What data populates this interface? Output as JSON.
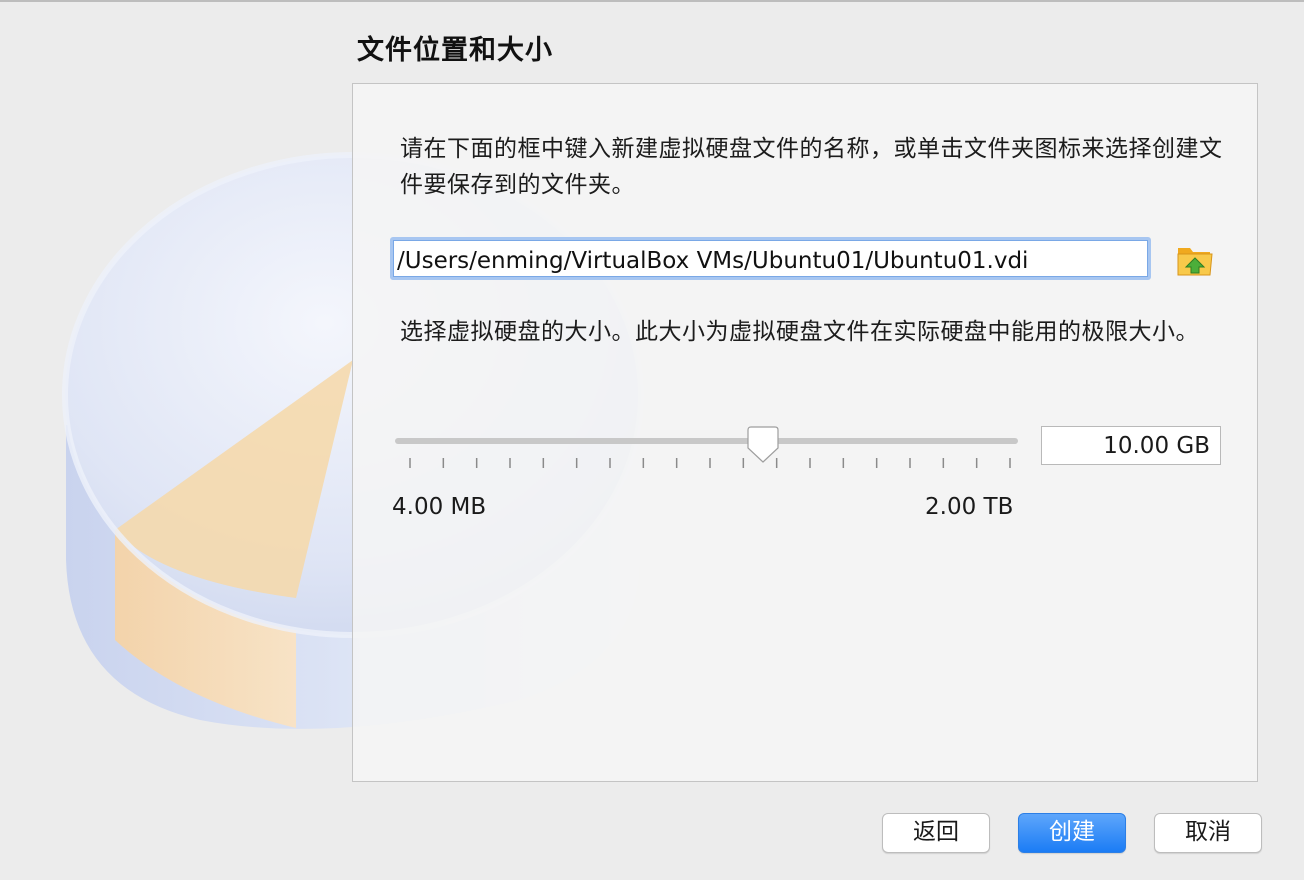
{
  "page": {
    "title": "文件位置和大小",
    "location_prompt": "请在下面的框中键入新建虚拟硬盘文件的名称，或单击文件夹图标来选择创建文件要保存到的文件夹。",
    "size_prompt": "选择虚拟硬盘的大小。此大小为虚拟硬盘文件在实际硬盘中能用的极限大小。"
  },
  "file_location": {
    "path": "/Users/enming/VirtualBox VMs/Ubuntu01/Ubuntu01.vdi",
    "folder_icon": "folder-icon"
  },
  "size": {
    "value_text": "10.00 GB",
    "min_label": "4.00 MB",
    "max_label": "2.00 TB",
    "slider_fraction": 0.59,
    "tick_count": 19
  },
  "buttons": {
    "back": "返回",
    "create": "创建",
    "cancel": "取消"
  },
  "colors": {
    "accent": "#1b7cf5",
    "input_focus": "#a7c6f1",
    "folder": "#f5b82e"
  }
}
